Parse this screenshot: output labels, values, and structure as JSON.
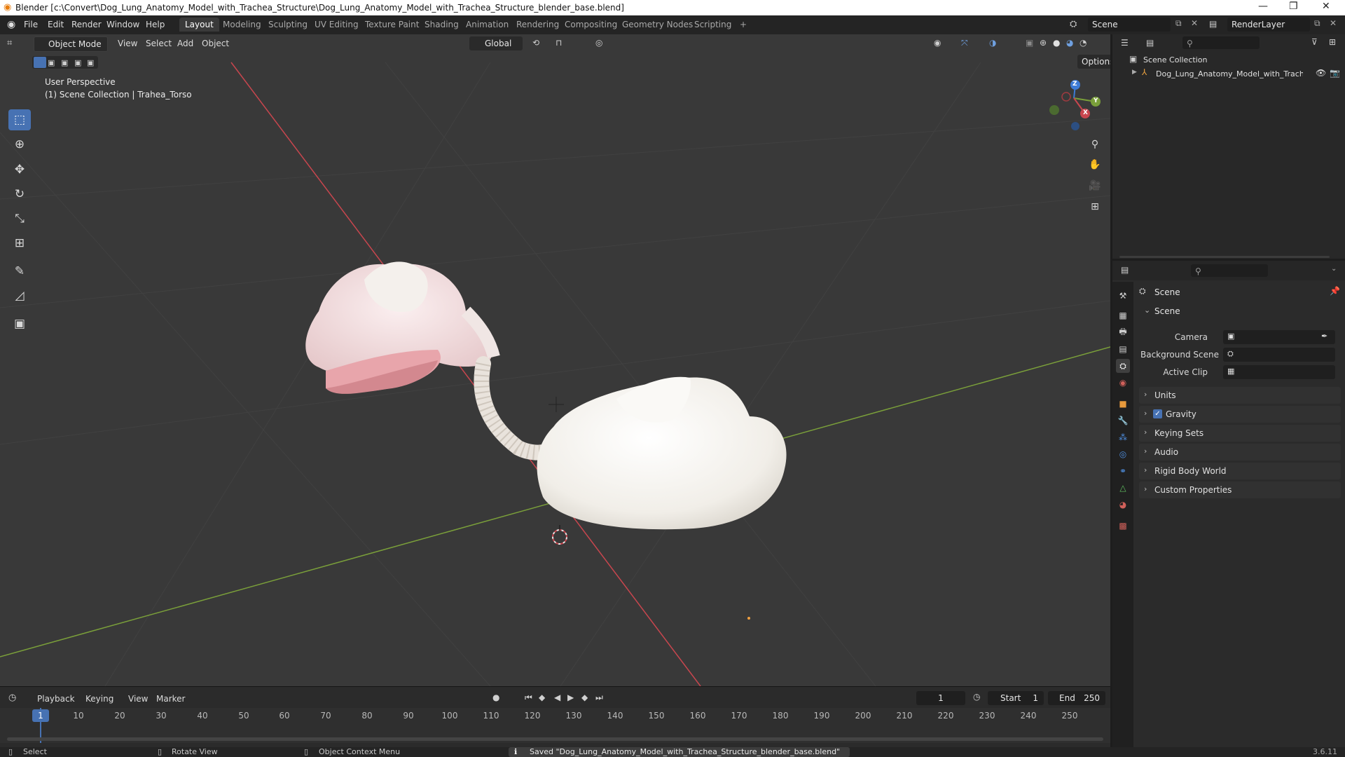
{
  "titlebar": {
    "title": "Blender [c:\\Convert\\Dog_Lung_Anatomy_Model_with_Trachea_Structure\\Dog_Lung_Anatomy_Model_with_Trachea_Structure_blender_base.blend]",
    "minimize": "—",
    "maximize": "❐",
    "close": "✕"
  },
  "menubar": {
    "items": [
      "File",
      "Edit",
      "Render",
      "Window",
      "Help"
    ]
  },
  "workspaces": {
    "tabs": [
      "Layout",
      "Modeling",
      "Sculpting",
      "UV Editing",
      "Texture Paint",
      "Shading",
      "Animation",
      "Rendering",
      "Compositing",
      "Geometry Nodes",
      "Scripting"
    ],
    "active": "Layout",
    "add": "+"
  },
  "scene_selector": {
    "value": "Scene"
  },
  "renderlayer_selector": {
    "value": "RenderLayer"
  },
  "viewport": {
    "mode": "Object Mode",
    "menus": [
      "View",
      "Select",
      "Add",
      "Object"
    ],
    "orientation": "Global",
    "options": "Options",
    "overlay_title": "User Perspective",
    "overlay_subtitle": "(1) Scene Collection | Trahea_Torso",
    "gizmo": {
      "z": "Z",
      "y": "Y",
      "x": "X"
    },
    "colors": {
      "x_axis": "#c8464e",
      "y_axis": "#7a9f3a",
      "z_axis": "#3d7bd6",
      "active_tool": "#4772b3"
    }
  },
  "tools": [
    {
      "name": "select-box",
      "icon": "▭"
    },
    {
      "name": "cursor",
      "icon": "⊕"
    },
    {
      "name": "move",
      "icon": "✥"
    },
    {
      "name": "rotate",
      "icon": "↻"
    },
    {
      "name": "scale",
      "icon": "⤡"
    },
    {
      "name": "transform",
      "icon": "⊞"
    },
    {
      "name": "annotate",
      "icon": "✎"
    },
    {
      "name": "measure",
      "icon": "📐"
    },
    {
      "name": "add-cube",
      "icon": "▣"
    }
  ],
  "timeline": {
    "menus": [
      "Playback",
      "Keying",
      "View",
      "Marker"
    ],
    "current_frame": "1",
    "start_label": "Start",
    "start_value": "1",
    "end_label": "End",
    "end_value": "250",
    "ticks": [
      "1",
      "10",
      "20",
      "30",
      "40",
      "50",
      "60",
      "70",
      "80",
      "90",
      "100",
      "110",
      "120",
      "130",
      "140",
      "150",
      "160",
      "170",
      "180",
      "190",
      "200",
      "210",
      "220",
      "230",
      "240",
      "250"
    ]
  },
  "outliner": {
    "root": "Scene Collection",
    "items": [
      "Dog_Lung_Anatomy_Model_with_Trache"
    ]
  },
  "properties": {
    "header": "Scene",
    "section": "Scene",
    "fields": [
      {
        "label": "Camera"
      },
      {
        "label": "Background Scene"
      },
      {
        "label": "Active Clip"
      }
    ],
    "panels": [
      "Units",
      "Gravity",
      "Keying Sets",
      "Audio",
      "Rigid Body World",
      "Custom Properties"
    ],
    "gravity_checked": true
  },
  "statusbar": {
    "select": "Select",
    "rotate": "Rotate View",
    "context": "Object Context Menu",
    "message": "Saved \"Dog_Lung_Anatomy_Model_with_Trachea_Structure_blender_base.blend\"",
    "version": "3.6.11"
  }
}
